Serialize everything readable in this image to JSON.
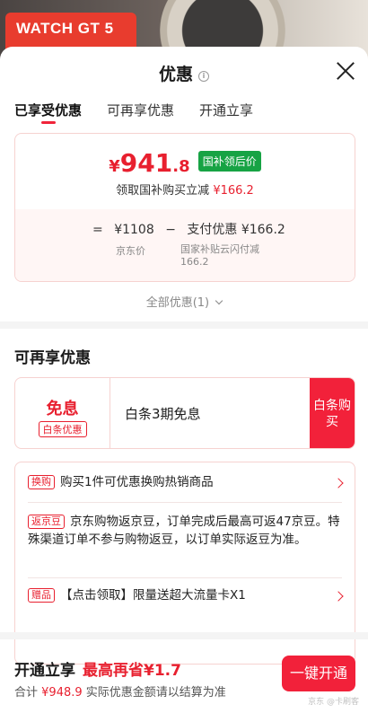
{
  "background": {
    "promo_text": "WATCH GT 5"
  },
  "sheet": {
    "title": "优惠",
    "tabs": [
      {
        "label": "已享受优惠"
      },
      {
        "label": "可再享优惠"
      },
      {
        "label": "开通立享"
      }
    ],
    "price": {
      "currency": "¥",
      "integer": "941",
      "decimal": ".8",
      "badge": "国补领后价",
      "subtitle_prefix": "领取国补购买立减",
      "subtitle_amount": "¥166.2",
      "formula": {
        "equals": "=",
        "jd_price": "¥1108",
        "minus": "−",
        "pay_discount": "支付优惠 ¥166.2",
        "jd_price_label": "京东价",
        "pay_discount_label": "国家补贴云闪付减166.2"
      }
    },
    "all_offers": "全部优惠(1)",
    "more_offers": {
      "title": "可再享优惠",
      "interest_free": {
        "headline": "免息",
        "badge": "白条优惠",
        "text": "白条3期免息",
        "button": "白条购买"
      },
      "items": [
        {
          "tag": "换购",
          "text": "购买1件可优惠换购热销商品"
        },
        {
          "tag": "返京豆",
          "text": "京东购物返京豆，订单完成后最高可返47京豆。特殊渠道订单不参与购物返豆，以订单实际返豆为准。"
        },
        {
          "tag": "赠品",
          "text": "【点击领取】限量送超大流量卡X1"
        }
      ]
    },
    "footer": {
      "title": "开通立享",
      "save": "最高再省¥1.7",
      "total_label": "合计",
      "total_amount": "¥948.9",
      "note": "实际优惠金额请以结算为准",
      "button": "一键开通",
      "watermark": "京东 @卡刷客"
    }
  }
}
